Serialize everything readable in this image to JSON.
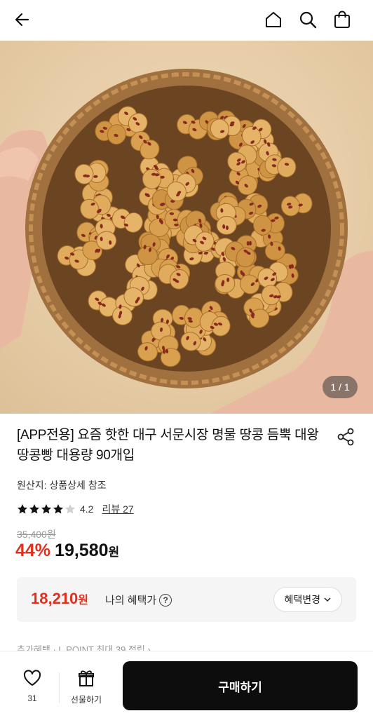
{
  "header": {
    "back_icon": "arrow-left-icon",
    "home_icon": "home-icon",
    "search_icon": "search-icon",
    "cart_icon": "shopping-bag-icon"
  },
  "gallery": {
    "counter": "1 / 1",
    "image_subject": "peanut-shaped bread in woven basket"
  },
  "product": {
    "title": "[APP전용] 요즘 핫한 대구 서문시장 명물 땅콩 듬뿍 대왕 땅콩빵 대용량 90개입",
    "origin": "원산지: 상품상세 참조",
    "rating": {
      "stars": 4.2,
      "score": "4.2",
      "review_link": "리뷰 27"
    },
    "original_price": "35,400원",
    "discount": "44%",
    "price": "19,580",
    "price_unit": "원"
  },
  "benefit": {
    "price": "18,210",
    "price_unit": "원",
    "label": "나의 혜택가",
    "change_button": "혜택변경"
  },
  "peek_text": "추가혜택  ·  L.POINT 최대 39 적립 ›",
  "bottom_bar": {
    "like_count": "31",
    "gift_label": "선물하기",
    "buy_button": "구매하기"
  },
  "colors": {
    "accent_red": "#e0301e",
    "buy_button_bg": "#0d0d0d"
  }
}
